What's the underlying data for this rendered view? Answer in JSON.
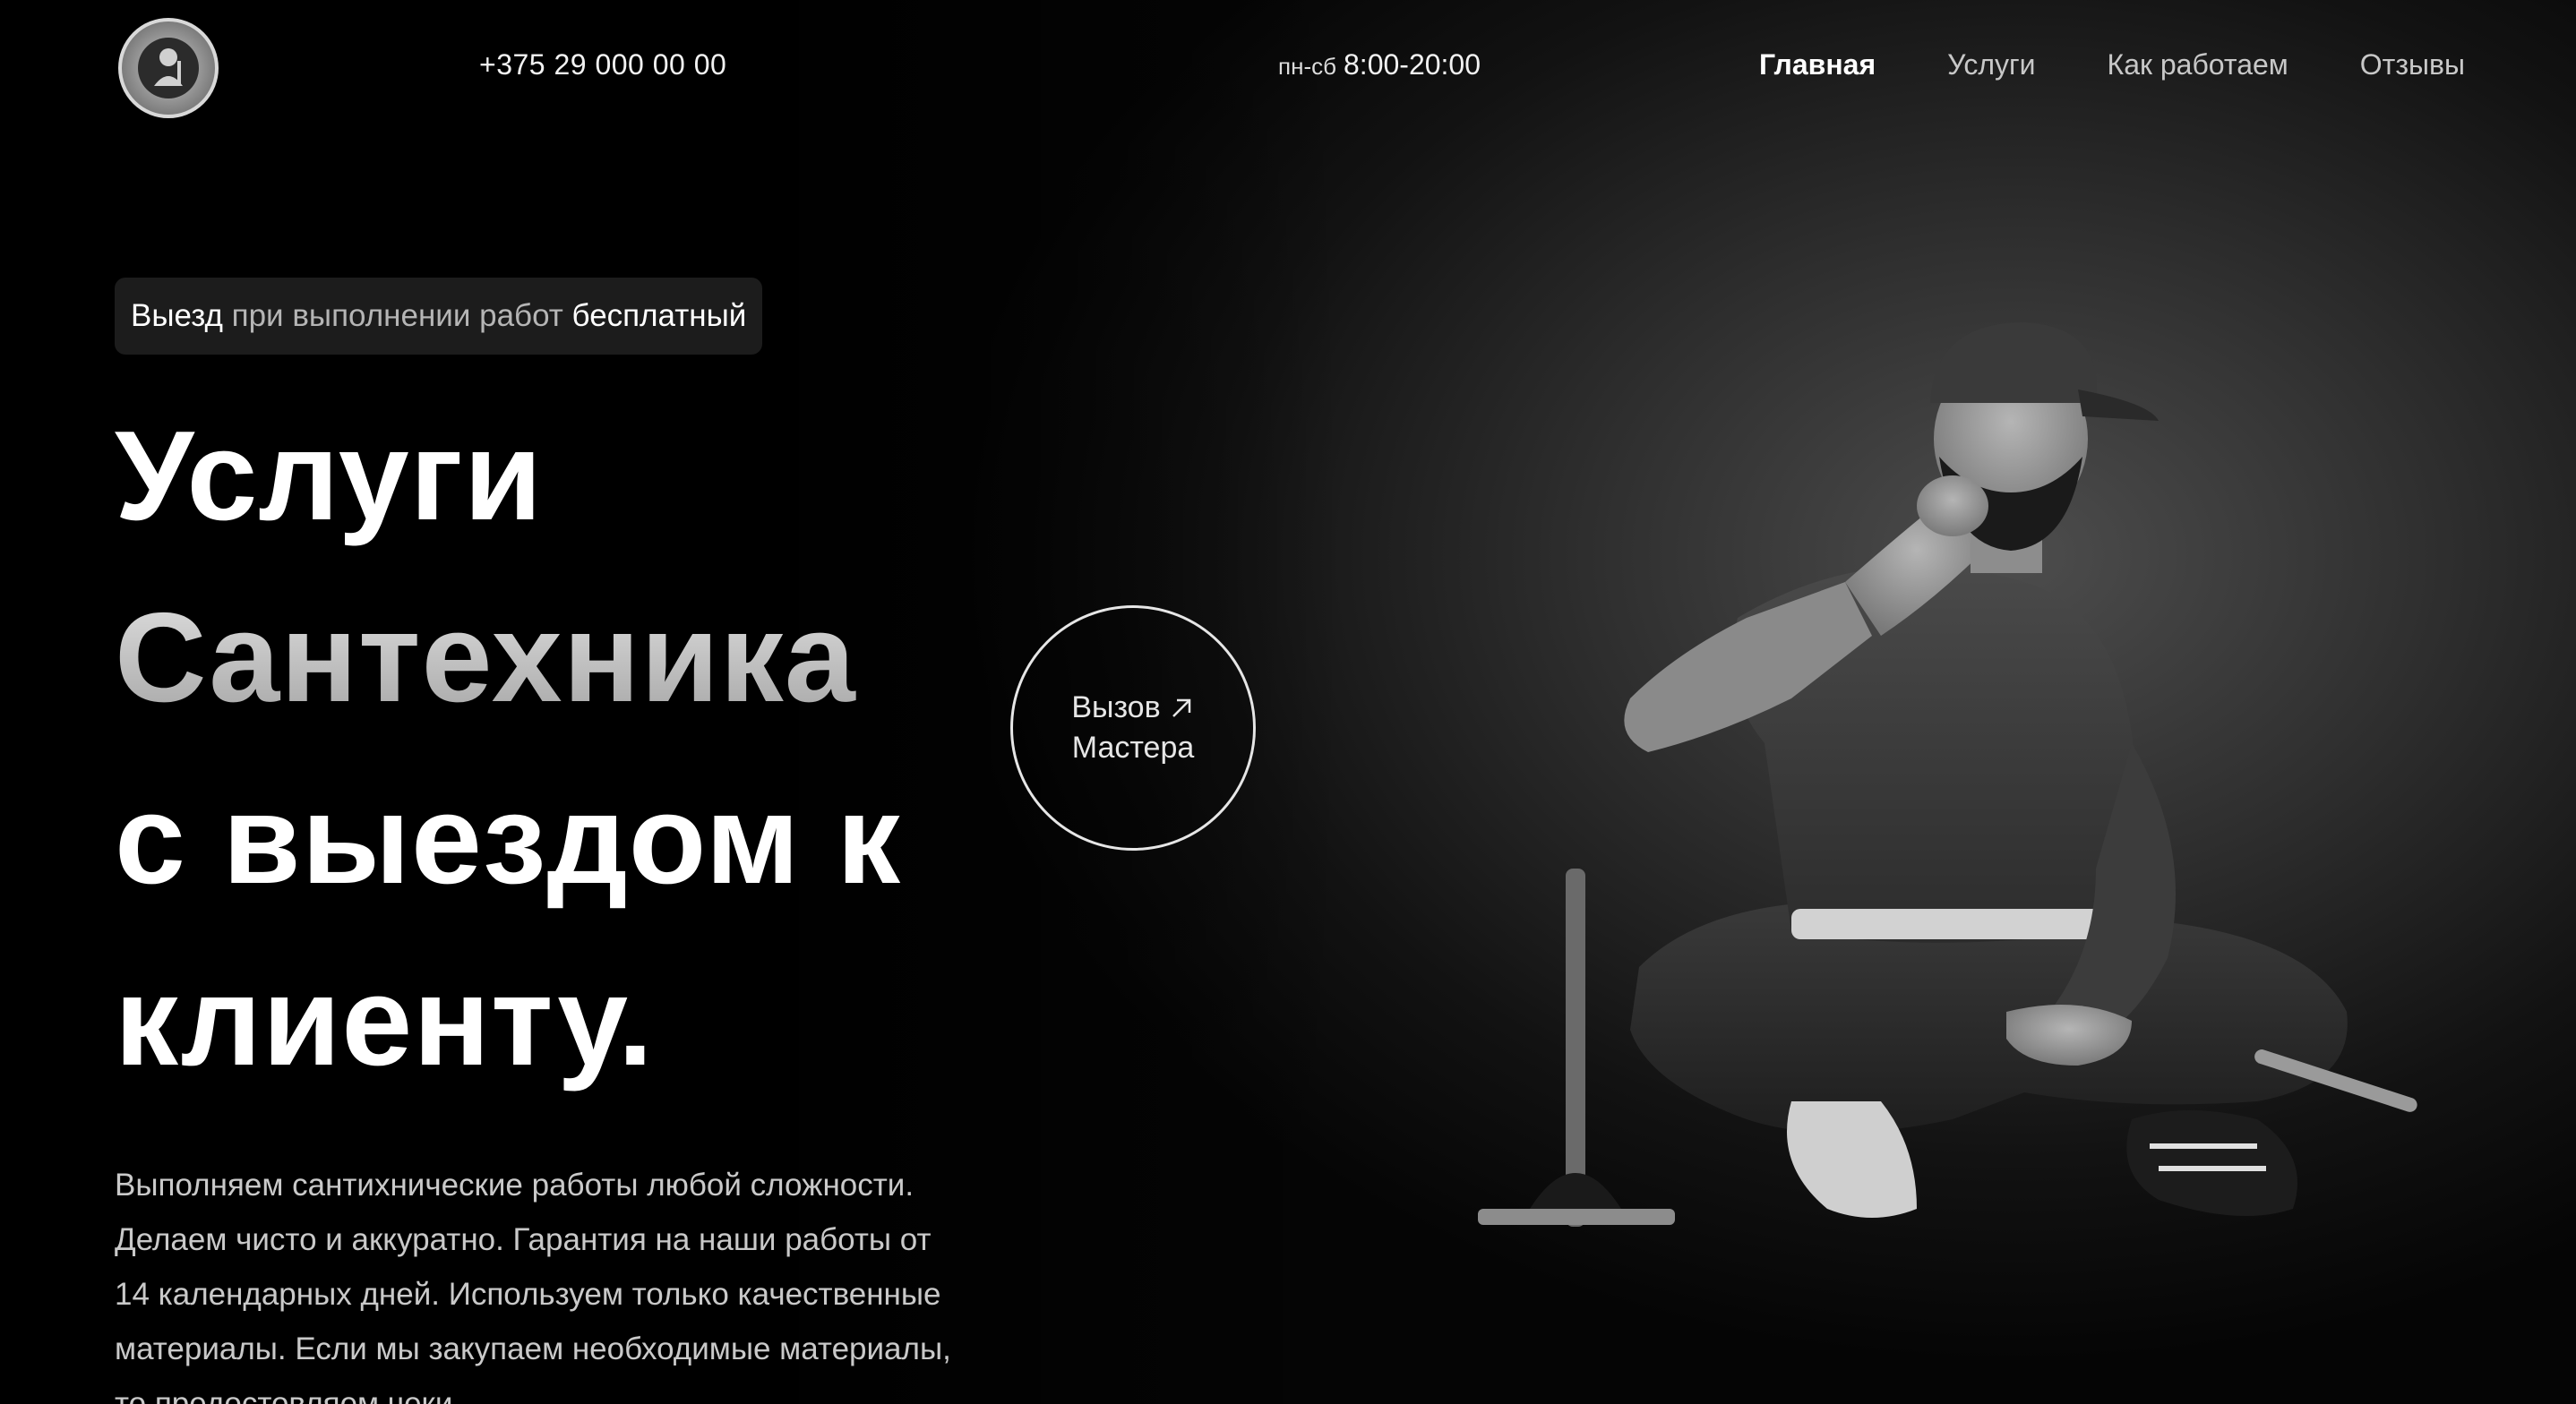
{
  "header": {
    "phone": "+375 29 000 00 00",
    "hours_days": "пн-сб",
    "hours_time": "8:00-20:00",
    "nav": [
      {
        "label": "Главная",
        "active": true
      },
      {
        "label": "Услуги",
        "active": false
      },
      {
        "label": "Как работаем",
        "active": false
      },
      {
        "label": "Отзывы",
        "active": false
      }
    ]
  },
  "hero": {
    "badge": {
      "part1": "Выезд",
      "part2": "при выполнении работ",
      "part3": "бесплатный"
    },
    "headline": {
      "line1": "Услуги",
      "line2": "Сантехника",
      "line3": "с выездом к",
      "line4": "клиенту."
    },
    "description": "Выполняем сантихнические работы любой сложности. Делаем чисто и аккуратно. Гарантия на наши работы от 14 календарных дней. Используем только качественные материалы. Если мы закупаем необходимые материалы, то предостовляем чеки.",
    "call_button": {
      "line1": "Вызов",
      "line2": "Мастера",
      "icon": "arrow-up-right-icon"
    }
  },
  "colors": {
    "background": "#000000",
    "text": "#ffffff",
    "muted": "#c9c9c9"
  }
}
